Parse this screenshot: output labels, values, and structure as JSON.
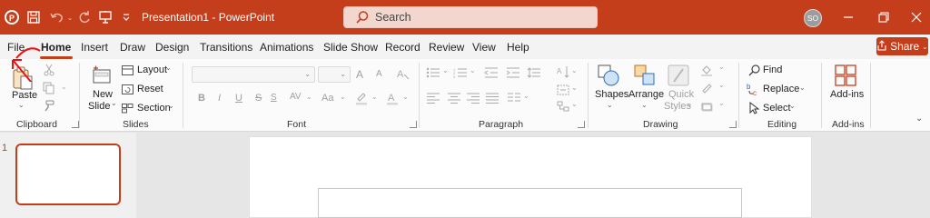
{
  "titlebar": {
    "doc_title": "Presentation1  -  PowerPoint",
    "search_placeholder": "Search",
    "avatar_initials": "SO"
  },
  "tabs": [
    "File",
    "Home",
    "Insert",
    "Draw",
    "Design",
    "Transitions",
    "Animations",
    "Slide Show",
    "Record",
    "Review",
    "View",
    "Help"
  ],
  "active_tab": "Home",
  "share_label": "Share",
  "groups": {
    "clipboard": {
      "label": "Clipboard",
      "paste": "Paste"
    },
    "slides": {
      "label": "Slides",
      "new_slide_line1": "New",
      "new_slide_line2": "Slide",
      "layout": "Layout",
      "reset": "Reset",
      "section": "Section"
    },
    "font": {
      "label": "Font"
    },
    "paragraph": {
      "label": "Paragraph"
    },
    "drawing": {
      "label": "Drawing",
      "shapes": "Shapes",
      "arrange": "Arrange",
      "quick_styles_line1": "Quick",
      "quick_styles_line2": "Styles"
    },
    "editing": {
      "label": "Editing",
      "find": "Find",
      "replace": "Replace",
      "select": "Select"
    },
    "addins": {
      "label": "Add-ins",
      "addins_btn": "Add-ins"
    }
  },
  "font_buttons": {
    "bold": "B",
    "italic": "I",
    "underline": "U",
    "strike": "S",
    "spacing": "AV",
    "case": "Aa",
    "grow": "A",
    "shrink": "A"
  },
  "slide_thumbnail_number": "1",
  "colors": {
    "accent": "#c43e1c",
    "ribbon_bg": "#fbfbfb",
    "tab_bg": "#f3f3f3"
  }
}
